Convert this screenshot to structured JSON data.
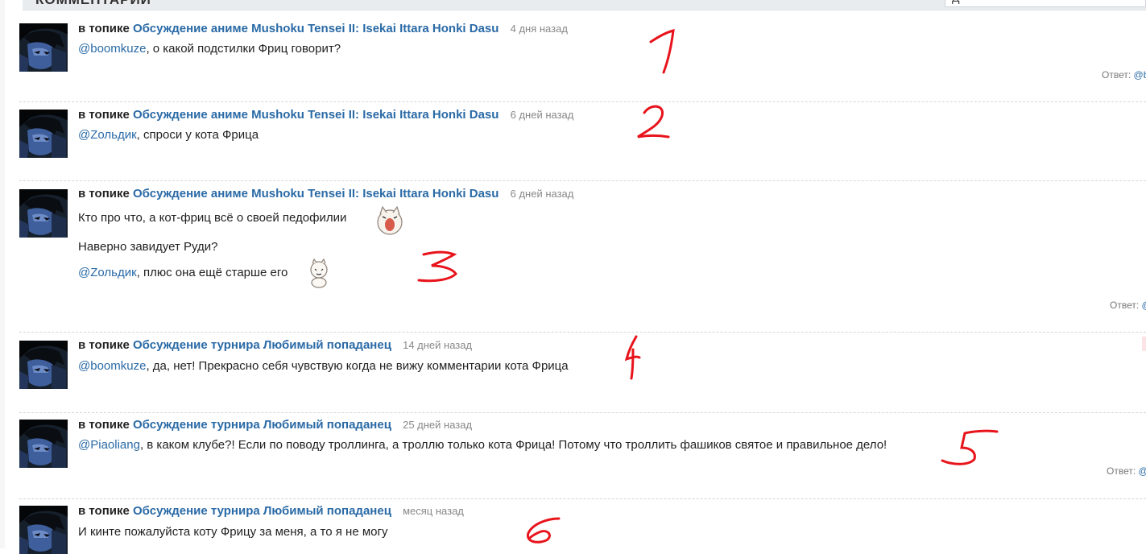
{
  "header": {
    "title": "КОММЕНТАРИИ",
    "search_text": "Д"
  },
  "prefix": "в топике",
  "comments": [
    {
      "topic": "Обсуждение аниме Mushoku Tensei II: Isekai Ittara Honki Dasu",
      "time": "4 дня назад",
      "lines": [
        {
          "mention": "@boomkuze",
          "text": ", о какой подстилки Фриц говорит?"
        }
      ],
      "reply": {
        "label": "Ответ:",
        "at": "@b"
      },
      "annotation": "1"
    },
    {
      "topic": "Обсуждение аниме Mushoku Tensei II: Isekai Ittara Honki Dasu",
      "time": "6 дней назад",
      "lines": [
        {
          "mention": "@Zольдик",
          "text": ", спроси у кота Фрица"
        }
      ],
      "annotation": "2"
    },
    {
      "topic": "Обсуждение аниме Mushoku Tensei II: Isekai Ittara Honki Dasu",
      "time": "6 дней назад",
      "lines": [
        {
          "text": "Кто про что, а кот-фриц всё о своей педофилии"
        },
        {
          "text": "Наверно завидует Руди?"
        },
        {
          "mention": "@Zольдик",
          "text": ", плюс она ещё старше его"
        }
      ],
      "reply": {
        "label": "Ответ:",
        "at": "@"
      },
      "annotation": "3"
    },
    {
      "topic": "Обсуждение турнира Любимый попаданец",
      "time": "14 дней назад",
      "lines": [
        {
          "mention": "@boomkuze",
          "text": ", да, нет! Прекрасно себя чувствую когда не вижу комментарии кота Фрица"
        }
      ],
      "annotation": "4"
    },
    {
      "topic": "Обсуждение турнира Любимый попаданец",
      "time": "25 дней назад",
      "lines": [
        {
          "mention": "@Piaoliang",
          "text": ", в каком клубе?! Если по поводу троллинга, а троллю только кота Фрица! Потому что троллить фашиков святое и правильное дело!"
        }
      ],
      "reply": {
        "label": "Ответ:",
        "at": "@"
      },
      "annotation": "5"
    },
    {
      "topic": "Обсуждение турнира Любимый попаданец",
      "time": "месяц назад",
      "lines": [
        {
          "text": "И кинте пожалуйста коту Фрицу за меня, а то я не могу"
        }
      ],
      "annotation": "6"
    }
  ],
  "colors": {
    "link": "#2a6aa6",
    "annotation": "#e8141c",
    "time": "#888888"
  }
}
